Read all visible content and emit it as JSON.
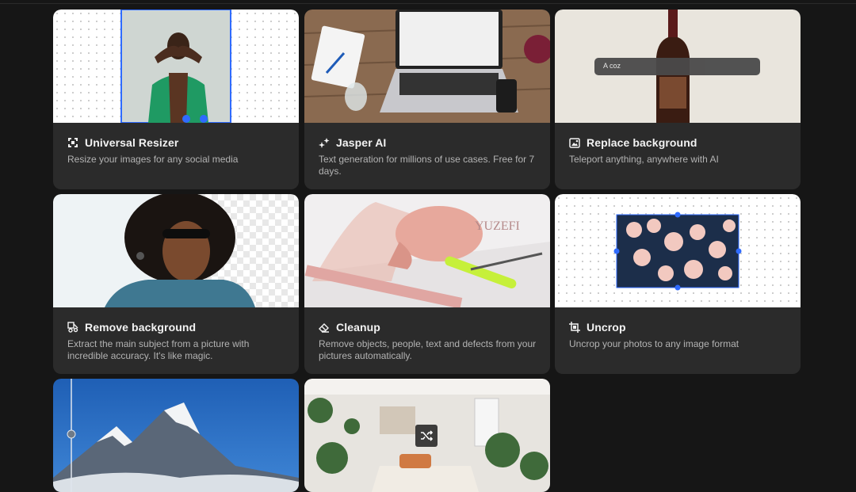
{
  "cards": [
    {
      "title": "Universal Resizer",
      "description": "Resize your images for any social media"
    },
    {
      "title": "Jasper AI",
      "description": "Text generation for millions of use cases. Free for 7 days."
    },
    {
      "title": "Replace background",
      "description": "Teleport anything, anywhere with AI",
      "prompt_text": "A coz"
    },
    {
      "title": "Remove background",
      "description": "Extract the main subject from a picture with incredible accuracy. It's like magic."
    },
    {
      "title": "Cleanup",
      "description": "Remove objects, people, text and defects from your pictures automatically."
    },
    {
      "title": "Uncrop",
      "description": "Uncrop your photos to any image format"
    },
    {
      "title": "",
      "description": ""
    },
    {
      "title": "",
      "description": ""
    }
  ],
  "colors": {
    "accent": "#2f6bff",
    "card_bg": "#2b2b2b",
    "page_bg": "#161616"
  },
  "icons": [
    "resize-icon",
    "sparkle-icon",
    "replace-bg-icon",
    "remove-bg-icon",
    "eraser-icon",
    "uncrop-icon",
    "shuffle-icon"
  ]
}
